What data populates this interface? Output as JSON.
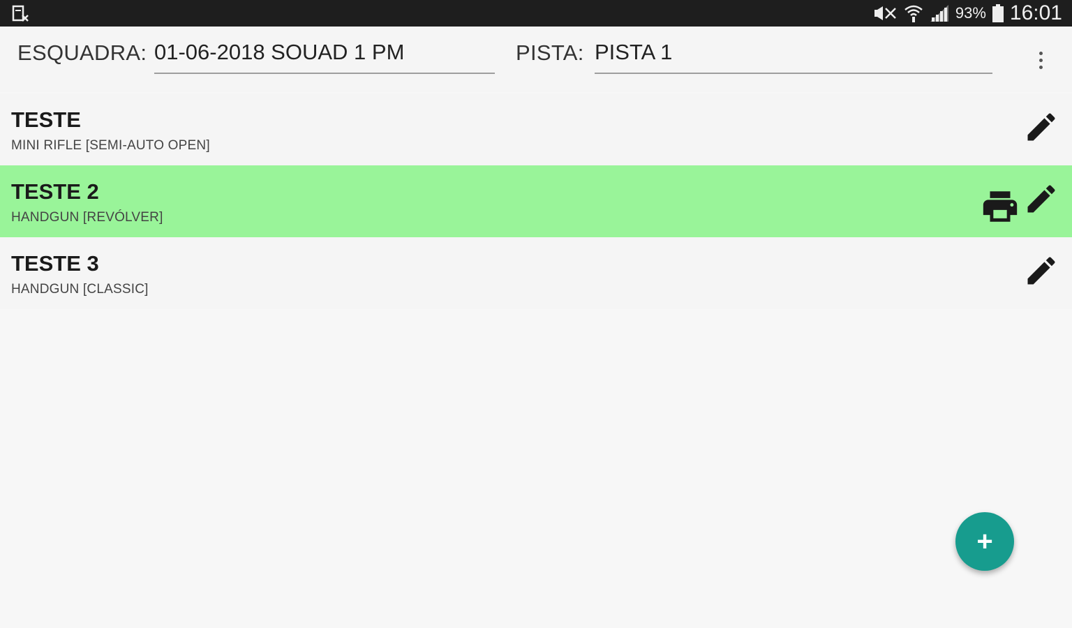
{
  "status_bar": {
    "battery_percent": "93%",
    "time": "16:01"
  },
  "header": {
    "squad_label": "ESQUADRA:",
    "squad_value": "01-06-2018 SOUAD 1 PM",
    "stage_label": "PISTA:",
    "stage_value": "PISTA 1"
  },
  "competitors": [
    {
      "name": "TESTE",
      "division": "MINI RIFLE [SEMI-AUTO OPEN]",
      "selected": false
    },
    {
      "name": "TESTE 2",
      "division": "HANDGUN [REVÓLVER]",
      "selected": true
    },
    {
      "name": "TESTE 3",
      "division": "HANDGUN [CLASSIC]",
      "selected": false
    }
  ],
  "fab": {
    "label": "+"
  },
  "colors": {
    "selected_row": "#99f499",
    "fab": "#179c8e",
    "status_bar": "#1e1e1e"
  }
}
